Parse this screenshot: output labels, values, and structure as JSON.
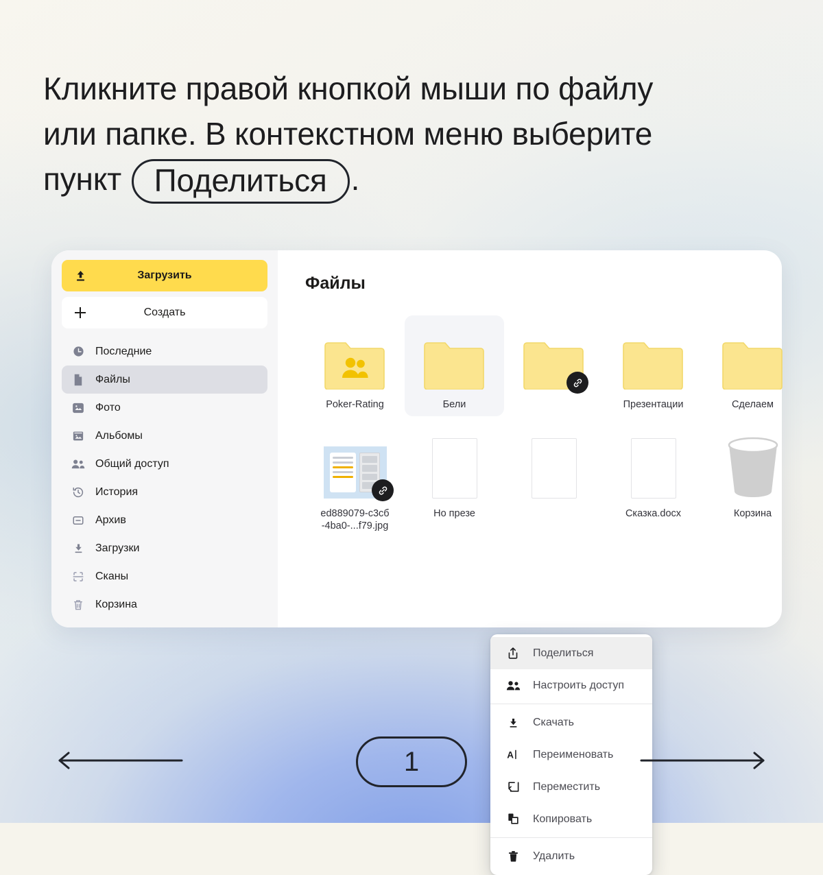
{
  "headline": {
    "line1": "Кликните правой кнопкой мыши по файлу",
    "line2": "или папке. В контекстном меню выберите",
    "line3_before": "пункт ",
    "pill": "Поделиться",
    "line3_after": "."
  },
  "sidebar": {
    "upload_label": "Загрузить",
    "upload_icon": "upload-icon",
    "create_label": "Создать",
    "create_icon": "plus-icon",
    "items": [
      {
        "label": "Последние",
        "icon": "clock-icon",
        "active": false
      },
      {
        "label": "Файлы",
        "icon": "file-icon",
        "active": true
      },
      {
        "label": "Фото",
        "icon": "photo-icon",
        "active": false
      },
      {
        "label": "Альбомы",
        "icon": "albums-icon",
        "active": false
      },
      {
        "label": "Общий доступ",
        "icon": "people-icon",
        "active": false
      },
      {
        "label": "История",
        "icon": "history-icon",
        "active": false
      },
      {
        "label": "Архив",
        "icon": "archive-icon",
        "active": false
      },
      {
        "label": "Загрузки",
        "icon": "download-icon",
        "active": false
      },
      {
        "label": "Сканы",
        "icon": "scan-icon",
        "active": false
      },
      {
        "label": "Корзина",
        "icon": "trash-icon",
        "active": false
      }
    ]
  },
  "content": {
    "title": "Файлы",
    "row1": [
      {
        "label": "Poker-Rating",
        "art": "folder-shared",
        "selected": false,
        "badge": ""
      },
      {
        "label": "Бели",
        "art": "folder",
        "selected": true,
        "badge": ""
      },
      {
        "label": "",
        "art": "folder",
        "selected": false,
        "badge": "link-badge"
      },
      {
        "label": "Презентации",
        "art": "folder",
        "selected": false,
        "badge": ""
      },
      {
        "label": "Сделаем",
        "art": "folder",
        "selected": false,
        "badge": ""
      }
    ],
    "row2": [
      {
        "label": "ed889079-c3cб -4ba0-...f79.jpg",
        "art": "image-thumb",
        "badge": "link-badge"
      },
      {
        "label": "Но презе",
        "art": "doc",
        "badge": ""
      },
      {
        "label": "",
        "art": "doc",
        "badge": ""
      },
      {
        "label": "Сказка.docx",
        "art": "doc",
        "badge": ""
      },
      {
        "label": "Корзина",
        "art": "bin",
        "badge": ""
      }
    ]
  },
  "context_menu": {
    "items": [
      {
        "label": "Поделиться",
        "icon": "share-icon",
        "highlighted": true,
        "sep_after": false
      },
      {
        "label": "Настроить доступ",
        "icon": "people-icon",
        "highlighted": false,
        "sep_after": true
      },
      {
        "label": "Скачать",
        "icon": "download-icon",
        "highlighted": false,
        "sep_after": false
      },
      {
        "label": "Переименовать",
        "icon": "rename-icon",
        "highlighted": false,
        "sep_after": false
      },
      {
        "label": "Переместить",
        "icon": "move-icon",
        "highlighted": false,
        "sep_after": false
      },
      {
        "label": "Копировать",
        "icon": "copy-icon",
        "highlighted": false,
        "sep_after": true
      },
      {
        "label": "Удалить",
        "icon": "trash-icon",
        "highlighted": false,
        "sep_after": false
      }
    ]
  },
  "pager": {
    "page": "1",
    "prev_icon": "arrow-left-icon",
    "next_icon": "arrow-right-icon"
  },
  "colors": {
    "accent_yellow": "#ffdb4d",
    "folder_yellow": "#fbe58f",
    "folder_border": "#f2d86a",
    "folder_person": "#f2c200",
    "text_dark": "#1c1b1a",
    "sidebar_bg": "#f6f6f7",
    "active_item": "#dddee4",
    "icon_gray": "#7e8191",
    "badge_dark": "#1d1d1f",
    "bin_gray": "#cfcfcf",
    "thumb_blue": "#cfe2f3"
  }
}
